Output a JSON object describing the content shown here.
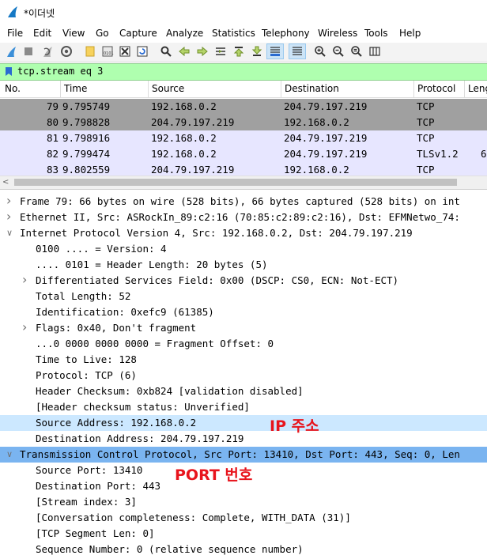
{
  "window": {
    "title": "*이더넷"
  },
  "menu": [
    "File",
    "Edit",
    "View",
    "Go",
    "Capture",
    "Analyze",
    "Statistics",
    "Telephony",
    "Wireless",
    "Tools",
    "Help"
  ],
  "toolbar": {
    "icons": [
      "start-capture",
      "stop-capture",
      "restart-capture",
      "capture-options",
      "open-file",
      "save-file",
      "close-file",
      "reload-file",
      "find-packet",
      "go-back",
      "go-forward",
      "go-to-packet",
      "go-first",
      "go-last",
      "auto-scroll",
      "colorize",
      "zoom-in",
      "zoom-out",
      "normal-size",
      "resize-columns"
    ]
  },
  "filter": {
    "value": "tcp.stream eq 3"
  },
  "packet_list": {
    "columns": [
      "No.",
      "Time",
      "Source",
      "Destination",
      "Protocol",
      "Leng"
    ],
    "rows": [
      {
        "no": "79",
        "time": "9.795749",
        "src": "192.168.0.2",
        "dst": "204.79.197.219",
        "proto": "TCP",
        "len": ""
      },
      {
        "no": "80",
        "time": "9.798828",
        "src": "204.79.197.219",
        "dst": "192.168.0.2",
        "proto": "TCP",
        "len": ""
      },
      {
        "no": "81",
        "time": "9.798916",
        "src": "192.168.0.2",
        "dst": "204.79.197.219",
        "proto": "TCP",
        "len": ""
      },
      {
        "no": "82",
        "time": "9.799474",
        "src": "192.168.0.2",
        "dst": "204.79.197.219",
        "proto": "TLSv1.2",
        "len": "6"
      },
      {
        "no": "83",
        "time": "9.802559",
        "src": "204.79.197.219",
        "dst": "192.168.0.2",
        "proto": "TCP",
        "len": ""
      }
    ]
  },
  "details": [
    {
      "arrow": ">",
      "text": "Frame 79: 66 bytes on wire (528 bits), 66 bytes captured (528 bits) on int",
      "indent": 0
    },
    {
      "arrow": ">",
      "text": "Ethernet II, Src: ASRockIn_89:c2:16 (70:85:c2:89:c2:16), Dst: EFMNetwo_74:",
      "indent": 0
    },
    {
      "arrow": "v",
      "text": "Internet Protocol Version 4, Src: 192.168.0.2, Dst: 204.79.197.219",
      "indent": 0
    },
    {
      "arrow": "",
      "text": "0100 .... = Version: 4",
      "indent": 1
    },
    {
      "arrow": "",
      "text": ".... 0101 = Header Length: 20 bytes (5)",
      "indent": 1
    },
    {
      "arrow": ">",
      "text": "Differentiated Services Field: 0x00 (DSCP: CS0, ECN: Not-ECT)",
      "indent": 1
    },
    {
      "arrow": "",
      "text": "Total Length: 52",
      "indent": 1
    },
    {
      "arrow": "",
      "text": "Identification: 0xefc9 (61385)",
      "indent": 1
    },
    {
      "arrow": ">",
      "text": "Flags: 0x40, Don't fragment",
      "indent": 1
    },
    {
      "arrow": "",
      "text": "...0 0000 0000 0000 = Fragment Offset: 0",
      "indent": 1
    },
    {
      "arrow": "",
      "text": "Time to Live: 128",
      "indent": 1
    },
    {
      "arrow": "",
      "text": "Protocol: TCP (6)",
      "indent": 1
    },
    {
      "arrow": "",
      "text": "Header Checksum: 0xb824 [validation disabled]",
      "indent": 1
    },
    {
      "arrow": "",
      "text": "[Header checksum status: Unverified]",
      "indent": 1
    },
    {
      "arrow": "",
      "text": "Source Address: 192.168.0.2",
      "indent": 1
    },
    {
      "arrow": "",
      "text": "Destination Address: 204.79.197.219",
      "indent": 1
    },
    {
      "arrow": "v",
      "text": "Transmission Control Protocol, Src Port: 13410, Dst Port: 443, Seq: 0, Len",
      "indent": 0
    },
    {
      "arrow": "",
      "text": "Source Port: 13410",
      "indent": 1
    },
    {
      "arrow": "",
      "text": "Destination Port: 443",
      "indent": 1
    },
    {
      "arrow": "",
      "text": "[Stream index: 3]",
      "indent": 1
    },
    {
      "arrow": "",
      "text": "[Conversation completeness: Complete, WITH_DATA (31)]",
      "indent": 1
    },
    {
      "arrow": "",
      "text": "[TCP Segment Len: 0]",
      "indent": 1
    },
    {
      "arrow": "",
      "text": "Sequence Number: 0    (relative sequence number)",
      "indent": 1
    }
  ],
  "annotations": {
    "ip": "IP 주소",
    "port": "PORT 번호"
  },
  "colors": {
    "filter_ok_bg": "#afffaf",
    "row_selected": "#a0a0a0",
    "row_tcp": "#e7e6ff",
    "detail_selected": "#cce8ff",
    "detail_header_selected": "#7ab4f0",
    "annotation_red": "#e8141c"
  }
}
